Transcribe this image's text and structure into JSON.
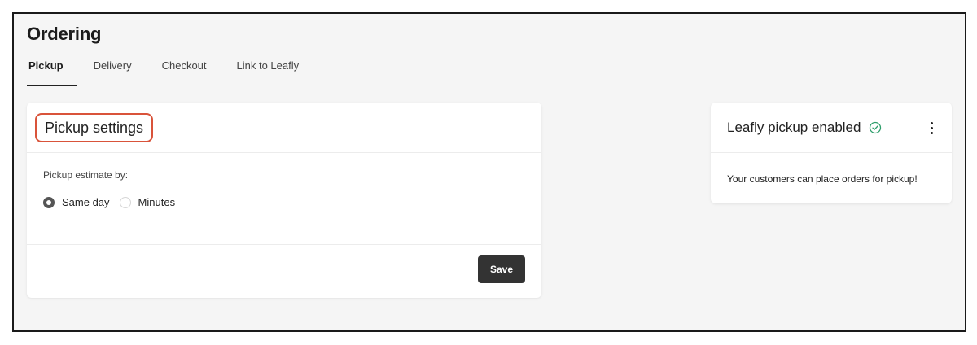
{
  "page": {
    "title": "Ordering"
  },
  "tabs": [
    {
      "label": "Pickup",
      "active": true
    },
    {
      "label": "Delivery",
      "active": false
    },
    {
      "label": "Checkout",
      "active": false
    },
    {
      "label": "Link to Leafly",
      "active": false
    }
  ],
  "pickup_settings": {
    "title": "Pickup settings",
    "estimate_label": "Pickup estimate by:",
    "options": [
      {
        "label": "Same day",
        "checked": true
      },
      {
        "label": "Minutes",
        "checked": false
      }
    ],
    "save_label": "Save"
  },
  "leafly_card": {
    "title": "Leafly pickup enabled",
    "status_icon": "check-circle-icon",
    "menu_icon": "kebab-menu-icon",
    "message": "Your customers can place orders for pickup!"
  },
  "colors": {
    "highlight": "#d9533a",
    "success": "#2e9e6b",
    "primary_button": "#333333"
  }
}
